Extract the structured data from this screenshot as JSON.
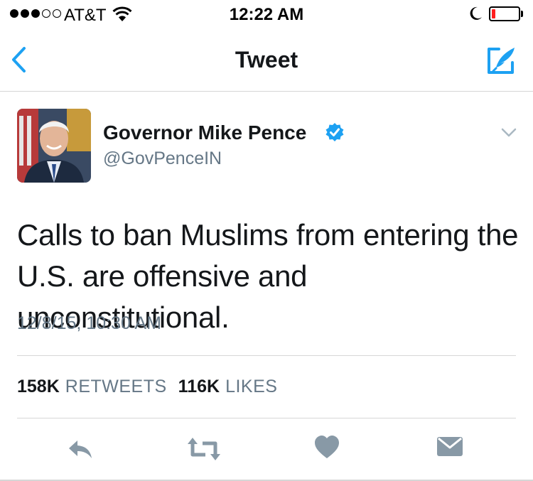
{
  "status_bar": {
    "carrier": "AT&T",
    "time": "12:22 AM",
    "signal_bars_filled": 3,
    "signal_bars_total": 5,
    "battery_level": 0.15,
    "battery_color": "#ff1f1f"
  },
  "nav": {
    "title": "Tweet",
    "back_icon": "chevron-left-icon",
    "compose_icon": "compose-tweet-icon",
    "accent_color": "#1da1f2"
  },
  "tweet": {
    "author": {
      "display_name": "Governor Mike Pence",
      "handle": "@GovPenceIN",
      "verified": true
    },
    "text": "Calls to ban Muslims from entering the U.S. are offensive and unconstitutional.",
    "timestamp": "12/8/15, 10:30 AM",
    "stats": {
      "retweets_count": "158K",
      "retweets_label": "RETWEETS",
      "likes_count": "116K",
      "likes_label": "LIKES"
    },
    "actions": [
      "reply-icon",
      "retweet-icon",
      "like-icon",
      "direct-message-icon"
    ]
  }
}
